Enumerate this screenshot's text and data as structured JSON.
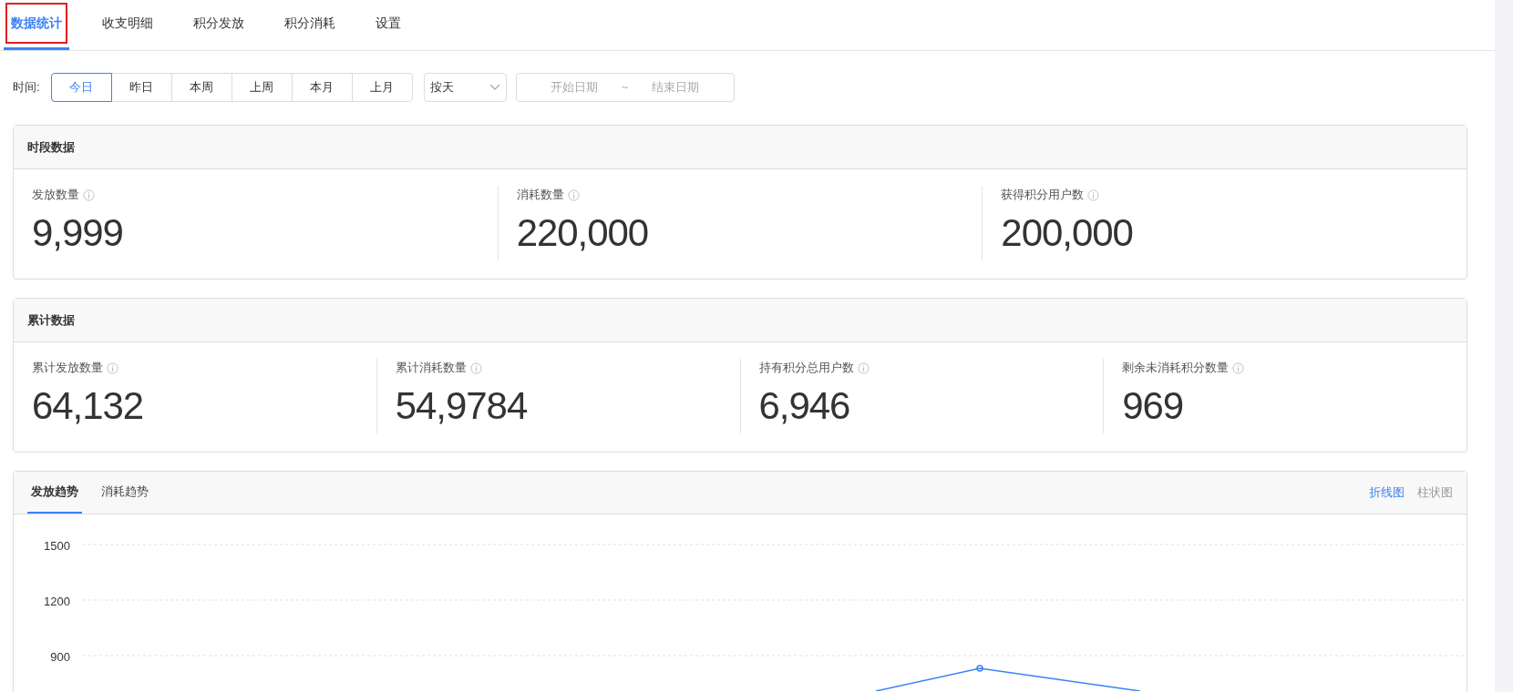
{
  "tabs": [
    {
      "label": "数据统计",
      "selected": true,
      "highlighted": true
    },
    {
      "label": "收支明细",
      "selected": false,
      "highlighted": false
    },
    {
      "label": "积分发放",
      "selected": false,
      "highlighted": false
    },
    {
      "label": "积分消耗",
      "selected": false,
      "highlighted": false
    },
    {
      "label": "设置",
      "selected": false,
      "highlighted": false
    }
  ],
  "filter": {
    "label": "时间:",
    "ranges": [
      {
        "label": "今日",
        "selected": true
      },
      {
        "label": "昨日",
        "selected": false
      },
      {
        "label": "本周",
        "selected": false
      },
      {
        "label": "上周",
        "selected": false
      },
      {
        "label": "本月",
        "selected": false
      },
      {
        "label": "上月",
        "selected": false
      }
    ],
    "granularity": "按天",
    "start_placeholder": "开始日期",
    "separator": "~",
    "end_placeholder": "结束日期"
  },
  "panels": [
    {
      "title": "时段数据",
      "stats": [
        {
          "label": "发放数量",
          "value": "9,999"
        },
        {
          "label": "消耗数量",
          "value": "220,000"
        },
        {
          "label": "获得积分用户数",
          "value": "200,000"
        }
      ]
    },
    {
      "title": "累计数据",
      "stats": [
        {
          "label": "累计发放数量",
          "value": "64,132"
        },
        {
          "label": "累计消耗数量",
          "value": "54,9784"
        },
        {
          "label": "持有积分总用户数",
          "value": "6,946"
        },
        {
          "label": "剩余未消耗积分数量",
          "value": "969"
        }
      ]
    }
  ],
  "trend": {
    "tabs": [
      {
        "label": "发放趋势",
        "selected": true
      },
      {
        "label": "消耗趋势",
        "selected": false
      }
    ],
    "chart_types": [
      {
        "label": "折线图",
        "selected": true
      },
      {
        "label": "柱状图",
        "selected": false
      }
    ],
    "y_axis_labels": [
      "1500",
      "1200",
      "900"
    ]
  }
}
